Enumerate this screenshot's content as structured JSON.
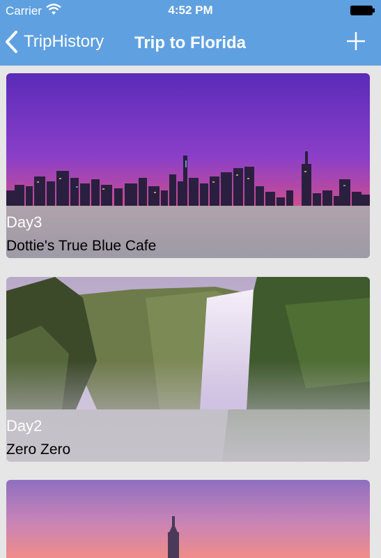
{
  "status_bar": {
    "carrier": "Carrier",
    "time": "4:52 PM",
    "wifi_icon": "wifi-icon",
    "battery_icon": "battery-icon"
  },
  "nav": {
    "back_label": "TripHistory",
    "title": "Trip to Florida",
    "add_icon": "plus-icon"
  },
  "colors": {
    "nav_background": "#5fa0e0",
    "page_background": "#e6e6e6",
    "overlay": "#bebebe"
  },
  "cards": [
    {
      "day": "Day3",
      "name": "Dottie's True Blue Cafe",
      "image": "city-skyline-night"
    },
    {
      "day": "Day2",
      "name": "Zero Zero",
      "image": "waterfall-landscape"
    },
    {
      "day": "",
      "name": "",
      "image": "city-tower-sunset"
    }
  ]
}
